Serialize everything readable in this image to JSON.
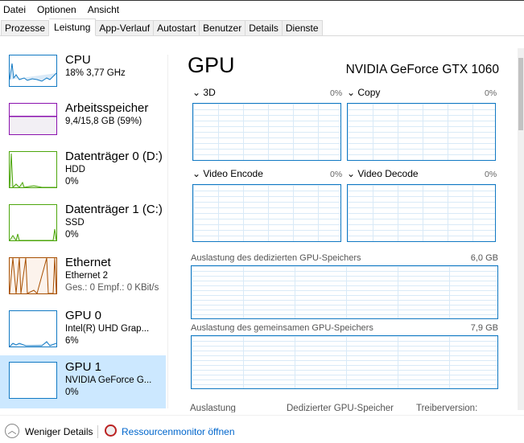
{
  "menu": [
    "Datei",
    "Optionen",
    "Ansicht"
  ],
  "tabs": [
    "Prozesse",
    "Leistung",
    "App-Verlauf",
    "Autostart",
    "Benutzer",
    "Details",
    "Dienste"
  ],
  "active_tab": "Leistung",
  "sidebar": [
    {
      "title": "CPU",
      "line1": "18%  3,77 GHz",
      "color": "#1179c3"
    },
    {
      "title": "Arbeitsspeicher",
      "line1": "9,4/15,8 GB (59%)",
      "color": "#8b12ae"
    },
    {
      "title": "Datenträger 0 (D:)",
      "line1": "HDD",
      "line2": "0%",
      "color": "#4da60c"
    },
    {
      "title": "Datenträger 1 (C:)",
      "line1": "SSD",
      "line2": "0%",
      "color": "#4da60c"
    },
    {
      "title": "Ethernet",
      "line1": "Ethernet 2",
      "line2": "Ges.: 0  Empf.: 0 KBit/s",
      "color": "#a74f01"
    },
    {
      "title": "GPU 0",
      "line1": "Intel(R) UHD Grap...",
      "line2": "6%",
      "color": "#1179c3"
    },
    {
      "title": "GPU 1",
      "line1": "NVIDIA GeForce G...",
      "line2": "0%",
      "color": "#1179c3"
    }
  ],
  "main": {
    "title": "GPU",
    "model": "NVIDIA GeForce GTX 1060",
    "engines": [
      {
        "label": "3D",
        "value": "0%"
      },
      {
        "label": "Copy",
        "value": "0%"
      },
      {
        "label": "Video Encode",
        "value": "0%"
      },
      {
        "label": "Video Decode",
        "value": "0%"
      }
    ],
    "dedicated_label": "Auslastung des dedizierten GPU-Speichers",
    "dedicated_value": "6,0 GB",
    "shared_label": "Auslastung des gemeinsamen GPU-Speichers",
    "shared_value": "7,9 GB",
    "stats": [
      "Auslastung",
      "Dedizierter GPU-Speicher",
      "Treiberversion:"
    ]
  },
  "footer": {
    "fewer": "Weniger Details",
    "resmon": "Ressourcenmonitor öffnen"
  }
}
